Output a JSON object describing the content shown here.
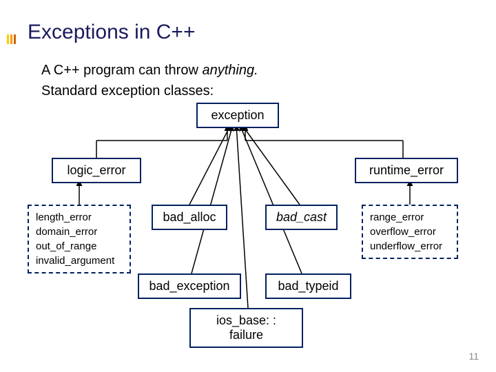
{
  "title": "Exceptions in C++",
  "intro_line1_a": "A C++ program can throw ",
  "intro_line1_b": "anything.",
  "intro_line2": "Standard exception classes:",
  "root": "exception",
  "left_parent": "logic_error",
  "right_parent": "runtime_error",
  "left_children": {
    "a": "length_error",
    "b": "domain_error",
    "c": "out_of_range",
    "d": "invalid_argument"
  },
  "mid_children": {
    "bad_alloc": "bad_alloc",
    "bad_cast": "bad_cast",
    "bad_exception": "bad_exception",
    "bad_typeid": "bad_typeid",
    "ios_failure": "ios_base: : failure"
  },
  "right_children": {
    "a": "range_error",
    "b": "overflow_error",
    "c": "underflow_error"
  },
  "page": "11",
  "chart_data": {
    "type": "hierarchy",
    "title": "C++ Standard Exception Class Hierarchy",
    "root": "exception",
    "children": [
      {
        "name": "logic_error",
        "children": [
          "length_error",
          "domain_error",
          "out_of_range",
          "invalid_argument"
        ]
      },
      {
        "name": "bad_alloc"
      },
      {
        "name": "bad_exception"
      },
      {
        "name": "ios_base::failure"
      },
      {
        "name": "bad_cast"
      },
      {
        "name": "bad_typeid"
      },
      {
        "name": "runtime_error",
        "children": [
          "range_error",
          "overflow_error",
          "underflow_error"
        ]
      }
    ]
  }
}
